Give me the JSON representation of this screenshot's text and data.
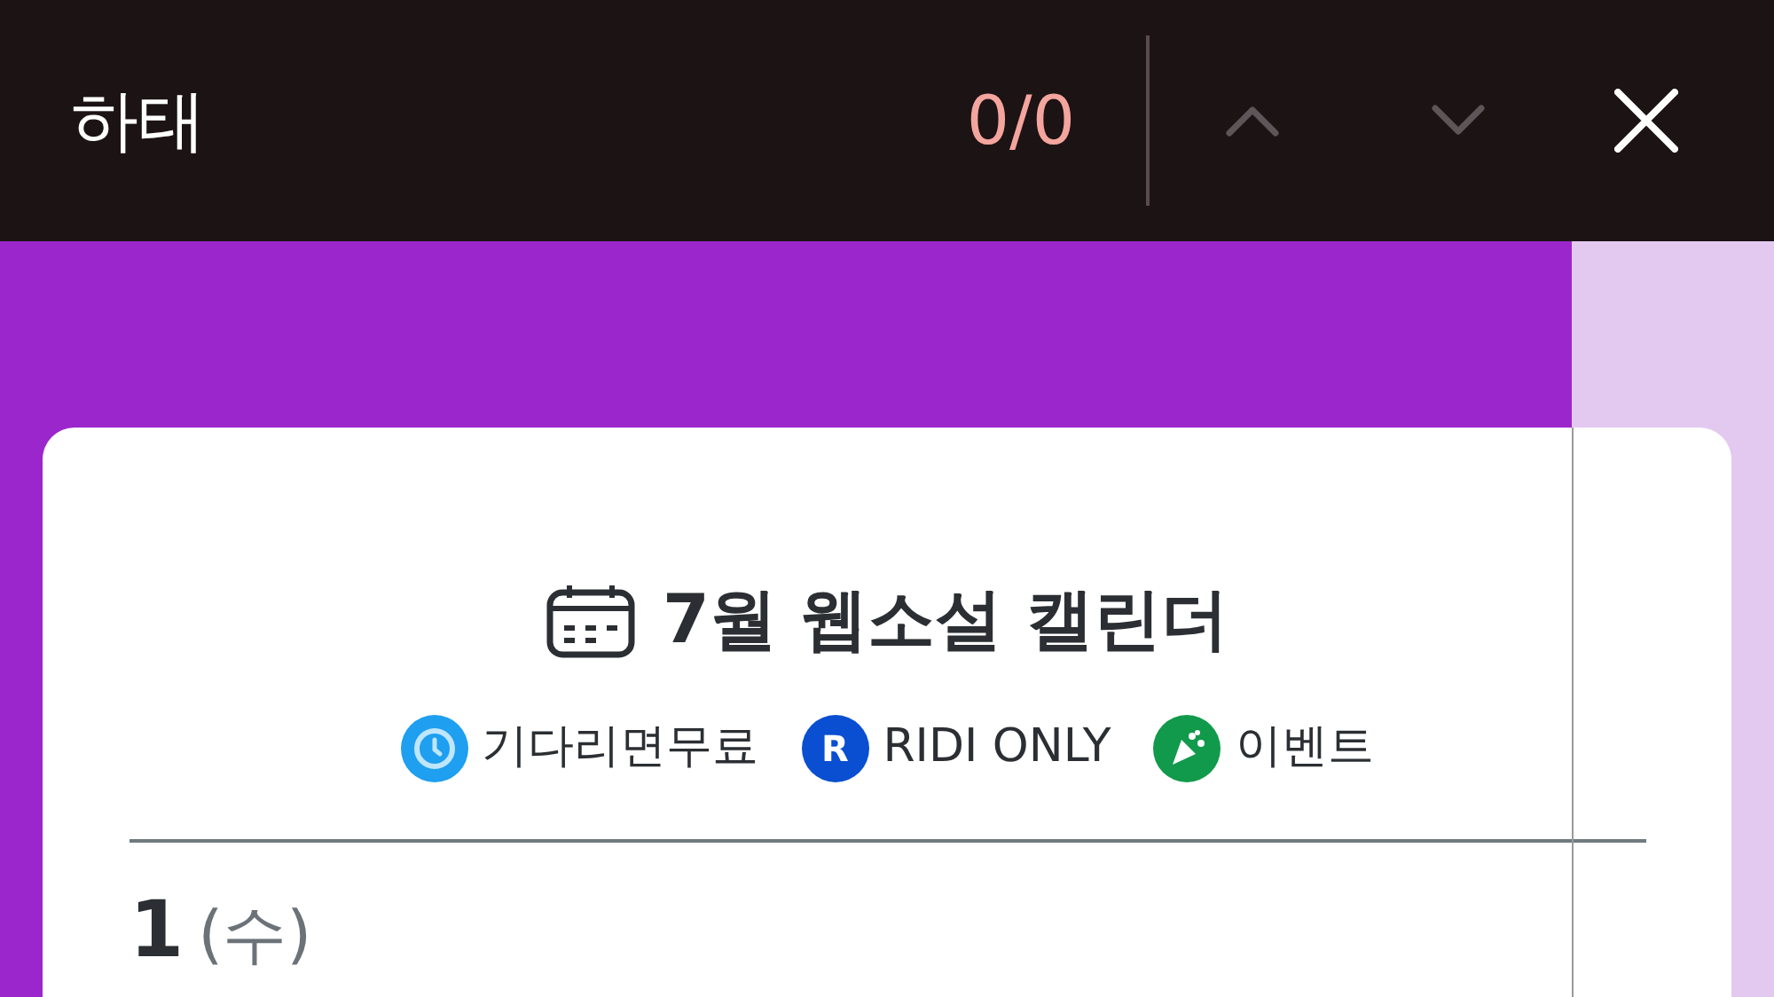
{
  "find_bar": {
    "query": "하태",
    "count": "0/0",
    "previous": {
      "disabled": true
    },
    "next": {
      "disabled": true
    }
  },
  "calendar": {
    "title": "7월 웹소설 캘린더",
    "legend": [
      {
        "kind": "clock",
        "label": "기다리면무료",
        "color": "#1e9ff0"
      },
      {
        "kind": "letter",
        "glyph": "R",
        "label": "RIDI ONLY",
        "color": "#0a4fd1"
      },
      {
        "kind": "party",
        "label": "이벤트",
        "color": "#119a4b"
      }
    ],
    "day": {
      "number": "1",
      "weekday": "(수)"
    }
  }
}
